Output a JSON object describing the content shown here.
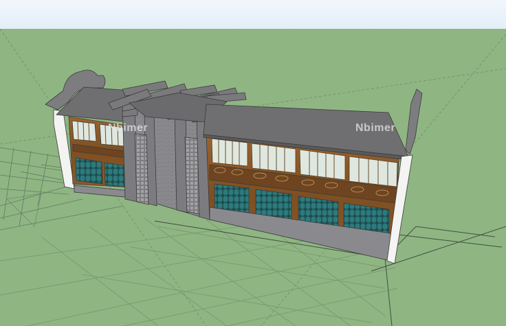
{
  "watermark": {
    "text": "Nbimer"
  },
  "colors": {
    "sky": "#e9f3fb",
    "ground": "#8fb583",
    "roof": "#6f6f71",
    "stone": "#8a8a8c",
    "wood": "#8b5a2b",
    "window_glass": "#dfe8e0",
    "door_glass": "#2f7f83",
    "wall_white": "#f4f4f2"
  },
  "icons": [
    "building-model"
  ]
}
